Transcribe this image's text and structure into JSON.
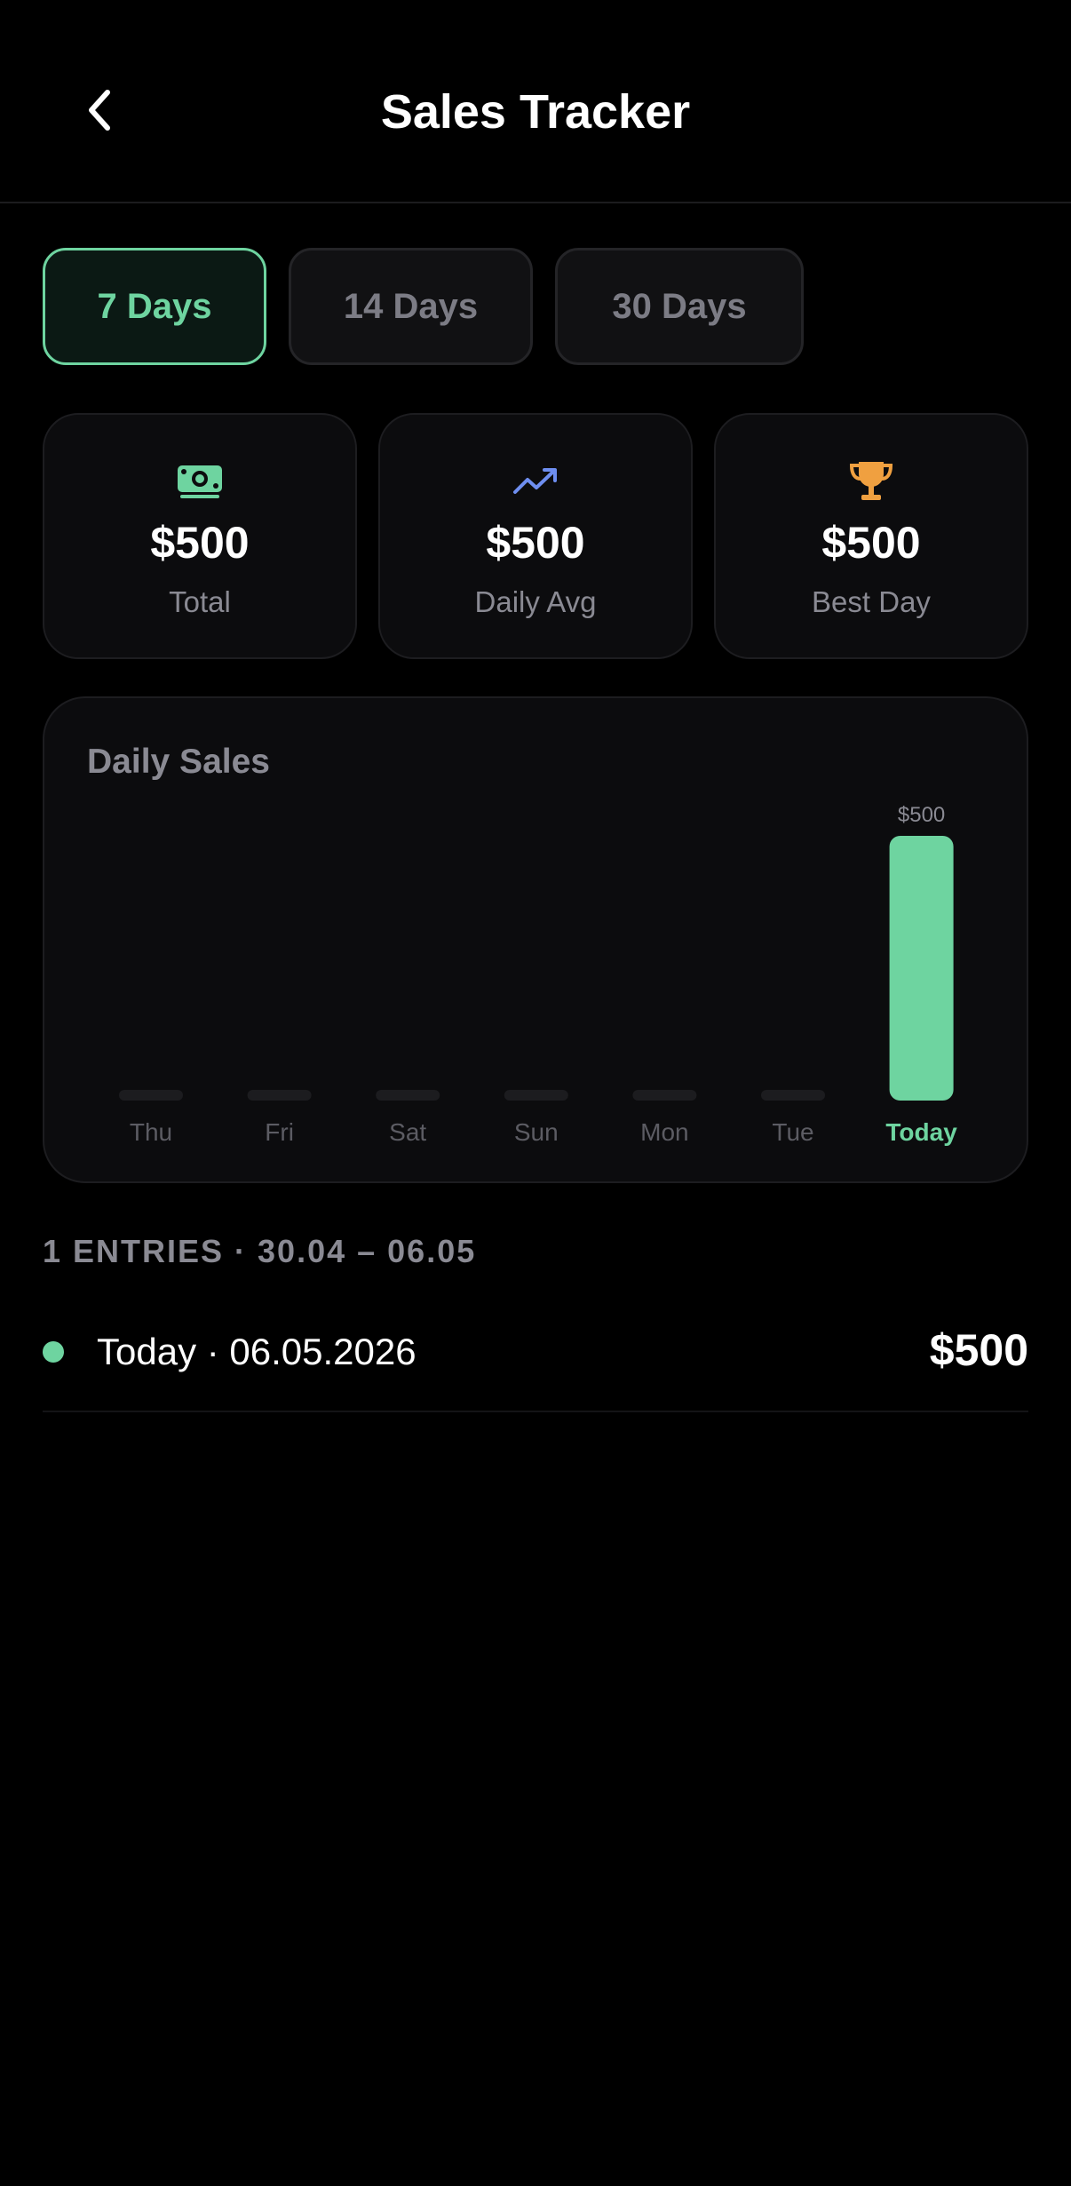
{
  "header": {
    "title": "Sales Tracker",
    "back_icon": "chevron-left-icon"
  },
  "tabs": [
    {
      "label": "7 Days",
      "active": true
    },
    {
      "label": "14 Days",
      "active": false
    },
    {
      "label": "30 Days",
      "active": false
    }
  ],
  "stats": [
    {
      "icon": "money-icon",
      "value": "$500",
      "label": "Total",
      "color": "#6ed4a0"
    },
    {
      "icon": "trending-up-icon",
      "value": "$500",
      "label": "Daily Avg",
      "color": "#6e8ef0"
    },
    {
      "icon": "trophy-icon",
      "value": "$500",
      "label": "Best Day",
      "color": "#f0a040"
    }
  ],
  "chart_data": {
    "type": "bar",
    "title": "Daily Sales",
    "categories": [
      "Thu",
      "Fri",
      "Sat",
      "Sun",
      "Mon",
      "Tue",
      "Today"
    ],
    "values": [
      0,
      0,
      0,
      0,
      0,
      0,
      500
    ],
    "value_labels": [
      "",
      "",
      "",
      "",
      "",
      "",
      "$500"
    ],
    "highlight_index": 6,
    "bar_color": "#6ed4a0",
    "empty_bar_color": "#1c1c1f",
    "ylim": [
      0,
      500
    ]
  },
  "entries": {
    "header": "1 ENTRIES · 30.04 – 06.05",
    "items": [
      {
        "label": "Today · 06.05.2026",
        "amount": "$500",
        "dot_color": "#6ed4a0"
      }
    ]
  }
}
